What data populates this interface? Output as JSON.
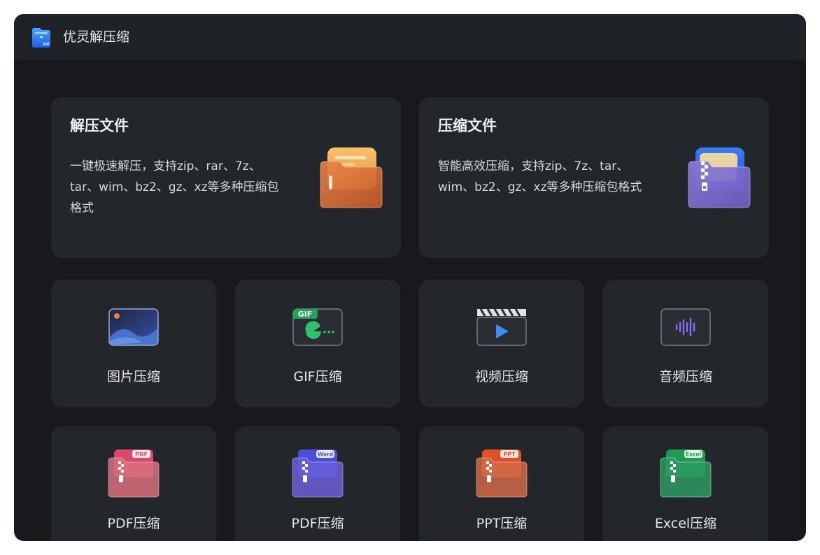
{
  "app": {
    "title": "优灵解压缩",
    "logo_text": "ZIP"
  },
  "feature_cards": [
    {
      "title": "解压文件",
      "description": "一键极速解压，支持zip、rar、7z、tar、wim、bz2、gz、xz等多种压缩包格式",
      "icon": "orange-folder-icon"
    },
    {
      "title": "压缩文件",
      "description": "智能高效压缩，支持zip、7z、tar、wim、bz2、gz、xz等多种压缩包格式",
      "icon": "purple-zip-folder-icon"
    }
  ],
  "tools": [
    {
      "label": "图片压缩",
      "icon": "image-icon"
    },
    {
      "label": "GIF压缩",
      "icon": "gif-icon",
      "badge": "GIF"
    },
    {
      "label": "视频压缩",
      "icon": "video-clapper-icon"
    },
    {
      "label": "音频压缩",
      "icon": "audio-wave-icon"
    },
    {
      "label": "PDF压缩",
      "icon": "pdf-zip-folder-icon",
      "badge": "PDF",
      "color": "#e0566f"
    },
    {
      "label": "PDF压缩",
      "icon": "word-zip-folder-icon",
      "badge": "Word",
      "color": "#5b5be6"
    },
    {
      "label": "PPT压缩",
      "icon": "ppt-zip-folder-icon",
      "badge": "PPT",
      "color": "#e3562f"
    },
    {
      "label": "Excel压缩",
      "icon": "excel-zip-folder-icon",
      "badge": "Excel",
      "color": "#22a35a"
    }
  ],
  "colors": {
    "window_bg": "#17191c",
    "titlebar_bg": "#1f2226",
    "card_bg": "#23262a"
  }
}
